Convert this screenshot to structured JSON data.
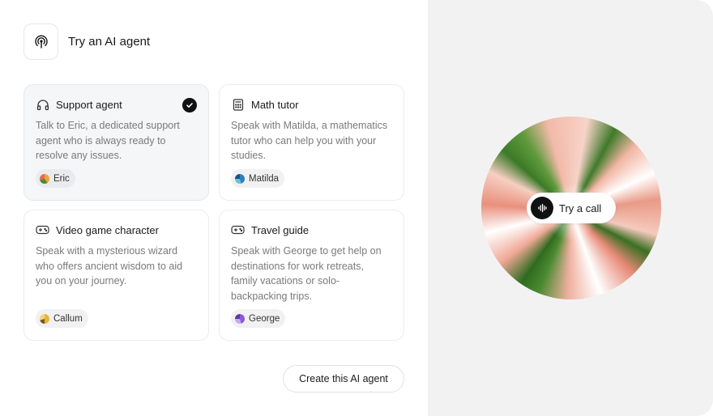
{
  "header": {
    "title": "Try an AI agent",
    "icon": "broadcast-icon"
  },
  "cards": [
    {
      "title": "Support agent",
      "icon": "headphones-icon",
      "description": "Talk to Eric, a dedicated support agent who is always ready to resolve any issues.",
      "voice": "Eric",
      "selected": true
    },
    {
      "title": "Math tutor",
      "icon": "calculator-icon",
      "description": "Speak with Matilda, a mathematics tutor who can help you with your studies.",
      "voice": "Matilda",
      "selected": false
    },
    {
      "title": "Video game character",
      "icon": "gamepad-icon",
      "description": "Speak with a mysterious wizard who offers ancient wisdom to aid you on your journey.",
      "voice": "Callum",
      "selected": false
    },
    {
      "title": "Travel guide",
      "icon": "gamepad-icon",
      "description": "Speak with George to get help on destinations for work retreats, family vacations or solo-backpacking trips.",
      "voice": "George",
      "selected": false
    }
  ],
  "actions": {
    "create_label": "Create this AI agent"
  },
  "call": {
    "label": "Try a call",
    "icon": "waveform-icon"
  },
  "colors": {
    "accent": "#111111",
    "orb_green": "#3f7a2a",
    "orb_salmon": "#e99a87",
    "panel_bg": "#f2f2f3"
  }
}
